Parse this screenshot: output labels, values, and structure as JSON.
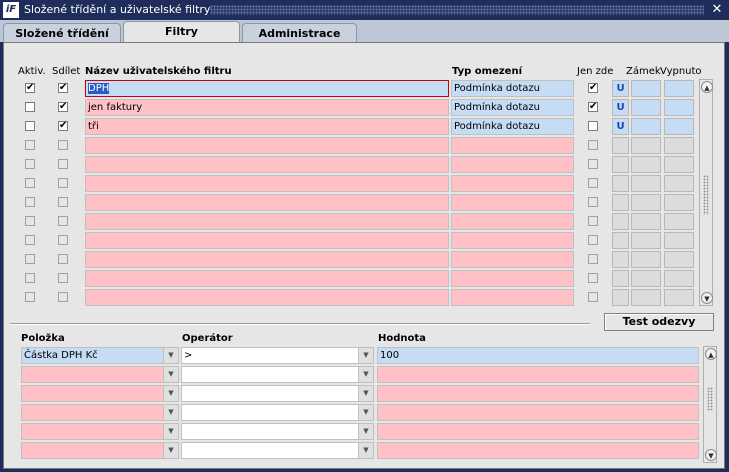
{
  "window": {
    "title": "Složené třídění a uživatelské filtry",
    "app_icon": "iF"
  },
  "tabs": [
    {
      "label": "Složené třídění"
    },
    {
      "label": "Filtry"
    },
    {
      "label": "Administrace filtrů"
    }
  ],
  "filters": {
    "headers": {
      "aktiv": "Aktiv.",
      "sdilet": "Sdílet",
      "nazev": "Název uživatelského filtru",
      "typ": "Typ omezení",
      "jen_zde": "Jen zde",
      "zamek": "Zámek",
      "vypnuto": "Vypnuto"
    },
    "rows": [
      {
        "aktiv": "✔",
        "sdilet": "✔",
        "nazev": "DPH",
        "typ": "Podmínka dotazu",
        "jen_zde": "✔",
        "u": "U"
      },
      {
        "aktiv": "",
        "sdilet": "✔",
        "nazev": "jen faktury",
        "typ": "Podmínka dotazu",
        "jen_zde": "✔",
        "u": "U"
      },
      {
        "aktiv": "",
        "sdilet": "✔",
        "nazev": "tři",
        "typ": "Podmínka dotazu",
        "jen_zde": "",
        "u": "U"
      }
    ],
    "empty_rows": 9
  },
  "test_button": "Test odezvy",
  "conditions": {
    "headers": {
      "polozka": "Položka",
      "operator": "Operátor",
      "hodnota": "Hodnota"
    },
    "rows": [
      {
        "polozka": "Částka DPH Kč",
        "operator": ">",
        "hodnota": "100"
      }
    ],
    "empty_rows": 5
  },
  "colors": {
    "titlebar": "#1f2d5a",
    "field_pink": "#ffc0c6",
    "field_blue": "#c6dcf5",
    "selection": "#2c5bc8"
  }
}
